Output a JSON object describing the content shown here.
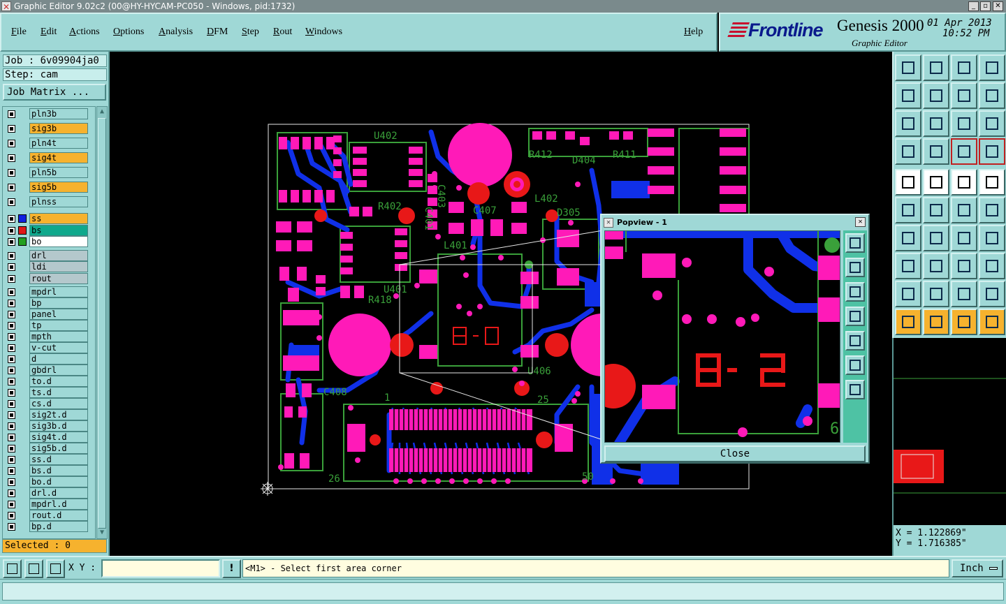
{
  "window": {
    "title": "Graphic Editor 9.02c2 (00@HY-HYCAM-PC050 - Windows, pid:1732)"
  },
  "menu": [
    "File",
    "Edit",
    "Actions",
    "Options",
    "Analysis",
    "DFM",
    "Step",
    "Rout",
    "Windows"
  ],
  "help_label": "Help",
  "brand": {
    "logo": "Frontline",
    "product": "Genesis 2000",
    "subtitle": "Graphic Editor",
    "date": "01 Apr 2013",
    "time": "10:52 PM"
  },
  "left": {
    "job": "Job : 6v09904ja0",
    "step": "Step: cam",
    "job_matrix": "Job Matrix ...",
    "selected": "Selected : 0"
  },
  "layers": [
    {
      "name": "pln3b",
      "color": "#9fd8d6"
    },
    {
      "name": "sig3b",
      "color": "#f6b22e"
    },
    {
      "name": "pln4t",
      "color": "#9fd8d6"
    },
    {
      "name": "sig4t",
      "color": "#f6b22e"
    },
    {
      "name": "pln5b",
      "color": "#9fd8d6"
    },
    {
      "name": "sig5b",
      "color": "#f6b22e"
    },
    {
      "name": "plnss",
      "color": "#9fd8d6"
    },
    {
      "name": "ss",
      "color": "#f6b22e",
      "swatch": "#1020e0"
    },
    {
      "name": "bs",
      "color": "#0fa88c",
      "swatch": "#e01818"
    },
    {
      "name": "bo",
      "color": "#ffffff",
      "swatch": "#22a020"
    },
    {
      "name": "drl",
      "color": "#b4c8cc"
    },
    {
      "name": "ldi",
      "color": "#b4c8cc"
    },
    {
      "name": "rout",
      "color": "#b4c8cc"
    },
    {
      "name": "mpdrl",
      "color": "#9fd8d6"
    },
    {
      "name": "bp",
      "color": "#9fd8d6"
    },
    {
      "name": "panel",
      "color": "#9fd8d6"
    },
    {
      "name": "tp",
      "color": "#9fd8d6"
    },
    {
      "name": "mpth",
      "color": "#9fd8d6"
    },
    {
      "name": "v-cut",
      "color": "#9fd8d6"
    },
    {
      "name": "d",
      "color": "#9fd8d6"
    },
    {
      "name": "gbdrl",
      "color": "#9fd8d6"
    },
    {
      "name": "to.d",
      "color": "#9fd8d6"
    },
    {
      "name": "ts.d",
      "color": "#9fd8d6"
    },
    {
      "name": "cs.d",
      "color": "#9fd8d6"
    },
    {
      "name": "sig2t.d",
      "color": "#9fd8d6"
    },
    {
      "name": "sig3b.d",
      "color": "#9fd8d6"
    },
    {
      "name": "sig4t.d",
      "color": "#9fd8d6"
    },
    {
      "name": "sig5b.d",
      "color": "#9fd8d6"
    },
    {
      "name": "ss.d",
      "color": "#9fd8d6"
    },
    {
      "name": "bs.d",
      "color": "#9fd8d6"
    },
    {
      "name": "bo.d",
      "color": "#9fd8d6"
    },
    {
      "name": "drl.d",
      "color": "#9fd8d6"
    },
    {
      "name": "mpdrl.d",
      "color": "#9fd8d6"
    },
    {
      "name": "rout.d",
      "color": "#9fd8d6"
    },
    {
      "name": "bp.d",
      "color": "#9fd8d6"
    }
  ],
  "pcb_labels": [
    "U402",
    "C403",
    "R402",
    "C401",
    "L401",
    "R418",
    "C407",
    "L402",
    "R412",
    "D404",
    "R411",
    "D305",
    "U406",
    "C408",
    "U401",
    "1",
    "25",
    "26",
    "50"
  ],
  "popview": {
    "title": "Popview - 1",
    "close_label": "Close"
  },
  "coords": {
    "x": "X = 1.122869\"",
    "y": "Y = 1.716385\""
  },
  "bottom": {
    "xy_label": "X Y :",
    "xy_value": "",
    "warn": "!",
    "prompt": "<M1> - Select first area corner",
    "units": "Inch"
  },
  "colors": {
    "panel": "#9fd8d6",
    "pad": "#ff1ab8",
    "trace": "#1030e8",
    "silk": "#3aa03a",
    "via": "#e81818"
  }
}
